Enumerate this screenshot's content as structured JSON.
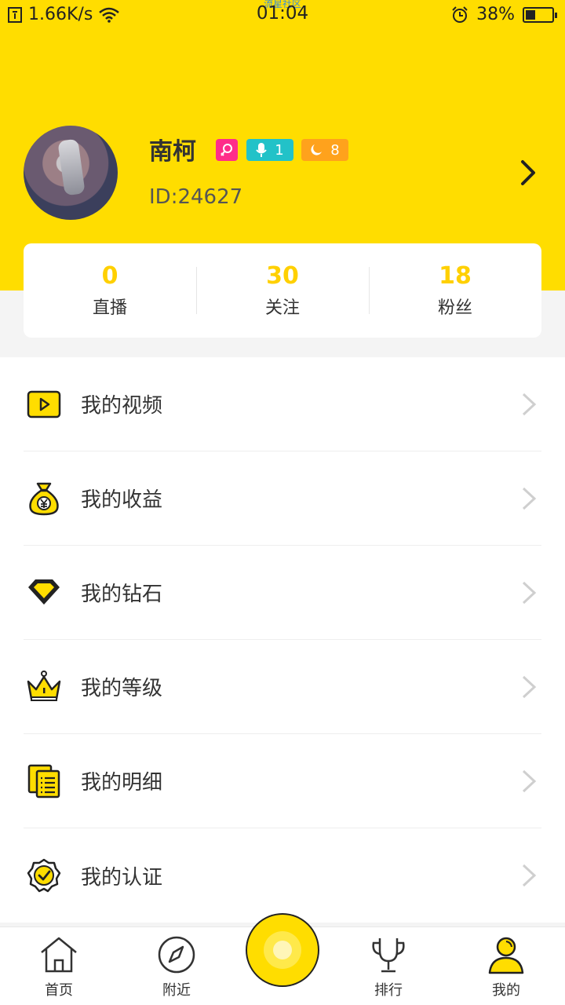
{
  "status_bar": {
    "network_speed": "1.66K/s",
    "time": "01:04",
    "carrier_text": "流星社区",
    "battery_percent": "38%",
    "battery_level": 0.38
  },
  "profile": {
    "name": "南柯",
    "anchor_level": "1",
    "user_level": "8",
    "id_text": "ID:24627"
  },
  "stats": [
    {
      "value": "0",
      "label": "直播"
    },
    {
      "value": "30",
      "label": "关注"
    },
    {
      "value": "18",
      "label": "粉丝"
    }
  ],
  "menu": [
    {
      "label": "我的视频",
      "icon": "video-icon"
    },
    {
      "label": "我的收益",
      "icon": "money-bag-icon"
    },
    {
      "label": "我的钻石",
      "icon": "diamond-icon"
    },
    {
      "label": "我的等级",
      "icon": "crown-icon"
    },
    {
      "label": "我的明细",
      "icon": "list-icon"
    },
    {
      "label": "我的认证",
      "icon": "verified-icon"
    }
  ],
  "bottom_nav": [
    {
      "label": "首页",
      "icon": "home-icon"
    },
    {
      "label": "附近",
      "icon": "compass-icon"
    },
    {
      "label": "排行",
      "icon": "trophy-icon"
    },
    {
      "label": "我的",
      "icon": "profile-icon"
    }
  ],
  "colors": {
    "brand_yellow": "#FFDD00",
    "gender_pink": "#ff2d8a",
    "anchor_teal": "#22c2c8",
    "level_orange": "#ffa21c"
  }
}
